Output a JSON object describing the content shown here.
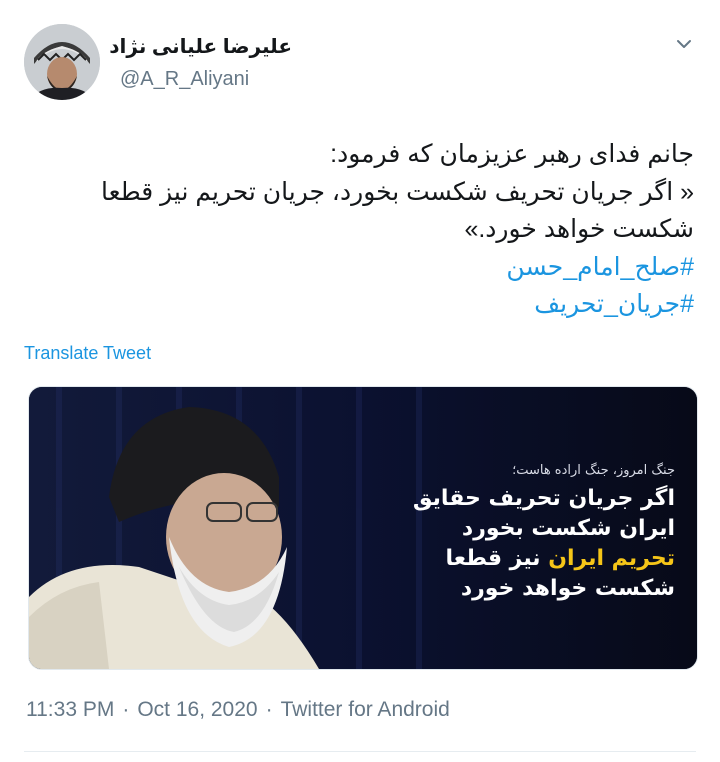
{
  "author": {
    "display_name": "علیرضا علیانی نژاد",
    "username": "@A_R_Aliyani"
  },
  "tweet": {
    "lines": [
      "جانم فدای رهبر عزیزمان که فرمود:",
      "« اگر جریان تحریف شکست بخورد، جریان تحریم نیز قطعا",
      "شکست خواهد خورد.»"
    ],
    "hashtags": [
      "#صلح_امام_حسن",
      "#جریان_تحریف"
    ],
    "translate_label": "Translate Tweet"
  },
  "media": {
    "caption_small": "جنگ امروز، جنگ اراده هاست؛",
    "line1": "اگر جریان تحریف حقایق",
    "line2": "ایران شکست بخورد",
    "line3_highlight": "تحریم ایران",
    "line3_rest": " نیز قطعا",
    "line4": "شکست خواهد خورد",
    "colors": {
      "highlight": "#f5c518",
      "background": "#0a0e1f"
    }
  },
  "meta": {
    "time": "11:33 PM",
    "date": "Oct 16, 2020",
    "source": "Twitter for Android",
    "separator": "·"
  },
  "icons": {
    "more": "chevron-down-icon"
  },
  "colors": {
    "link": "#1b95e0",
    "secondary_text": "#657786",
    "primary_text": "#14171a"
  }
}
